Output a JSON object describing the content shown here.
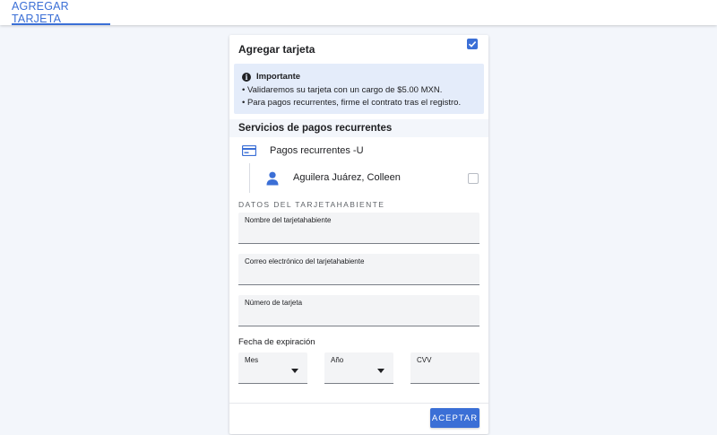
{
  "tabs": [
    {
      "label": "AGREGAR TARJETA",
      "active": true
    }
  ],
  "card": {
    "title": "Agregar tarjeta"
  },
  "info": {
    "icon": "info-icon",
    "title": "Importante",
    "lines": [
      "• Validaremos su tarjeta con un cargo de $5.00 MXN.",
      "• Para pagos recurrentes, firme el contrato tras el registro."
    ]
  },
  "services": {
    "title": "Servicios de pagos recurrentes",
    "item": {
      "icon": "credit-card-icon",
      "label": "Pagos recurrentes -U",
      "checked": true
    },
    "person": {
      "icon": "person-icon",
      "label": "Aguilera Juárez, Colleen",
      "checked": false
    }
  },
  "cardholder": {
    "heading": "DATOS DEL TARJETAHABIENTE",
    "fields": [
      {
        "label": "Nombre del tarjetahabiente",
        "value": ""
      },
      {
        "label": "Correo electrónico del tarjetahabiente",
        "value": ""
      },
      {
        "label": "Número de tarjeta",
        "value": ""
      }
    ],
    "expiration": {
      "label": "Fecha de expiración",
      "month": {
        "label": "Mes",
        "value": ""
      },
      "year": {
        "label": "Año",
        "value": ""
      },
      "cvv": {
        "label": "CVV",
        "value": ""
      }
    }
  },
  "actions": {
    "accept_label": "ACEPTAR"
  },
  "colors": {
    "accent": "#3b6fd6",
    "info_bg": "#e4ecfa",
    "page_bg": "#f3f6fb"
  }
}
